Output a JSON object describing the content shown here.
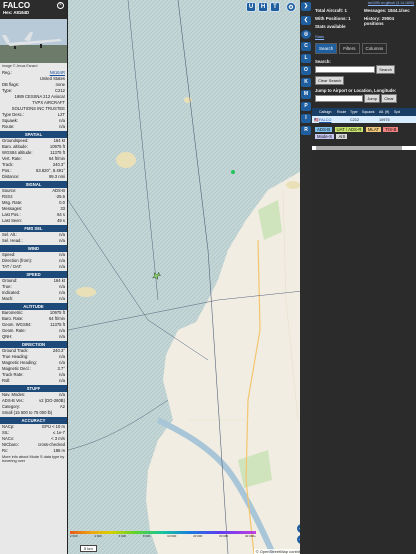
{
  "aircraft": {
    "callsign": "FALCO",
    "hex_line": "Hex: A8164D",
    "photo_credit": "Image © Jesus Esnard"
  },
  "registration": [
    {
      "k": "Reg.:",
      "v": "N6164R"
    },
    {
      "k": "",
      "v": "United States"
    },
    {
      "k": "DB flags:",
      "v": "none"
    },
    {
      "k": "Type:",
      "v": "C212"
    }
  ],
  "type_desc_line1": "1989 CESSNA 212 Aviocar",
  "type_desc_line2": "TVPX AIRCRAFT",
  "type_desc_line3": "SOLUTIONS INC TRUSTEE",
  "type_rows": [
    {
      "k": "Type Desc.:",
      "v": "L2T"
    },
    {
      "k": "Squawk:",
      "v": "n/a"
    },
    {
      "k": "Route:",
      "v": "n/a"
    }
  ],
  "sections": {
    "spatial": "SPATIAL",
    "signal": "SIGNAL",
    "fms": "FMS SEL",
    "wind": "WIND",
    "speed": "SPEED",
    "altitude": "ALTITUDE",
    "direction": "DIRECTION",
    "stuff": "STUFF",
    "accuracy": "ACCURACY"
  },
  "spatial": [
    {
      "k": "Groundspeed:",
      "v": "164 kt"
    },
    {
      "k": "Baro. altitude:",
      "v": "10975 ft"
    },
    {
      "k": "WGS84 altitude:",
      "v": "11375 ft"
    },
    {
      "k": "Vert. Rate:",
      "v": "64 ft/min"
    },
    {
      "k": "Track:",
      "v": "240.3°"
    },
    {
      "k": "Pos.:",
      "v": "53.820°, 8.491°"
    },
    {
      "k": "Distance:",
      "v": "99.3 nmi"
    }
  ],
  "signal": [
    {
      "k": "Source:",
      "v": "ADS-B"
    },
    {
      "k": "RSSI:",
      "v": "-25.6"
    },
    {
      "k": "Msg. Rate:",
      "v": "0.0"
    },
    {
      "k": "Messages:",
      "v": "33"
    },
    {
      "k": "Last Pos.:",
      "v": "64 s"
    },
    {
      "k": "Last Seen:",
      "v": "49 s"
    }
  ],
  "fms": [
    {
      "k": "Sel. Alt.:",
      "v": "n/a"
    },
    {
      "k": "Sel. Head.:",
      "v": "n/a"
    }
  ],
  "wind": [
    {
      "k": "Speed:",
      "v": "n/a"
    },
    {
      "k": "Direction (from):",
      "v": "n/a"
    },
    {
      "k": "TAT / OAT:",
      "v": "n/a"
    }
  ],
  "speed": [
    {
      "k": "Ground:",
      "v": "164 kt"
    },
    {
      "k": "True:",
      "v": "n/a"
    },
    {
      "k": "Indicated:",
      "v": "n/a"
    },
    {
      "k": "Mach:",
      "v": "n/a"
    }
  ],
  "altitude": [
    {
      "k": "Barometric:",
      "v": "10975 ft"
    },
    {
      "k": "Baro. Rate:",
      "v": "64 ft/min"
    },
    {
      "k": "Geom. WGS84:",
      "v": "11375 ft"
    },
    {
      "k": "Geom. Rate:",
      "v": "n/a"
    },
    {
      "k": "QNH:",
      "v": "n/a"
    }
  ],
  "direction": [
    {
      "k": "Ground Track:",
      "v": "240.3°"
    },
    {
      "k": "True Heading:",
      "v": "n/a"
    },
    {
      "k": "Magnetic Heading:",
      "v": "n/a"
    },
    {
      "k": "Magnetic Decl.:",
      "v": "3.7°"
    },
    {
      "k": "Track Rate:",
      "v": "n/a"
    },
    {
      "k": "Roll:",
      "v": "n/a"
    }
  ],
  "stuff": [
    {
      "k": "Nav. Modes:",
      "v": "n/a"
    },
    {
      "k": "ADS-B Ver.:",
      "v": "v2 (DO-260B)"
    },
    {
      "k": "Category:",
      "v": "A2"
    }
  ],
  "stuff_note": "Small (15 500 to 75 000 lb)",
  "accuracy": [
    {
      "k": "NACp:",
      "v": "EPU < 10 m"
    },
    {
      "k": "SIL:",
      "v": "≤ 1e-7"
    },
    {
      "k": "NACv:",
      "v": "< 3 m/s"
    },
    {
      "k": "NICbaro:",
      "v": "cross-checked"
    },
    {
      "k": "Rc:",
      "v": "186 m"
    }
  ],
  "bottom_hint": "More info about Mode S data type by hovering over",
  "map_buttons": [
    "U",
    "H",
    "T"
  ],
  "strip_buttons": [
    "C",
    "L",
    "O",
    "K",
    "M",
    "P",
    "I",
    "R"
  ],
  "zoom": {
    "in": "+",
    "out": "−"
  },
  "legend_ticks": [
    "2 000",
    "4 000",
    "6 000",
    "8 000",
    "10 000",
    "20 000",
    "30 000",
    "40 000+"
  ],
  "scale_label": "5 km",
  "attribution": "© OpenStreetMap contributors",
  "right_panel": {
    "version": "tar1090 on github (3.14.1690)",
    "total_aircraft": "Total Aircraft: 1",
    "with_positions": "With Positions: 1",
    "stats_available": "Stats available",
    "messages": "Messages: 1844.1/sec",
    "history": "History: 29004 positions",
    "stats_link": "Stats",
    "tabs": [
      "Search",
      "Filters",
      "Columns"
    ],
    "search_label": "Search:",
    "search_button": "Search",
    "clear_search": "Clear Search",
    "jump_label": "Jump to Airport or Location, Longitude:",
    "jump_button": "Jump",
    "clear_button": "Clear",
    "columns": [
      "",
      "Callsign",
      "Route",
      "Type",
      "Squawk",
      "Alt. (ft)",
      "Spd"
    ],
    "row": {
      "flag": "🇺🇸",
      "callsign": "FALCO",
      "type": "C212",
      "alt": "10975"
    },
    "chips": [
      {
        "label": "ADS-B",
        "color": "#7ec0ee"
      },
      {
        "label": "UAT / ADS-R",
        "color": "#c9e46a"
      },
      {
        "label": "MLAT",
        "color": "#f3c87d"
      },
      {
        "label": "TIS-B",
        "color": "#f08080"
      },
      {
        "label": "Mode-S",
        "color": "#c6c6f5"
      },
      {
        "label": "AIS",
        "color": "#d9d9d9"
      }
    ]
  }
}
